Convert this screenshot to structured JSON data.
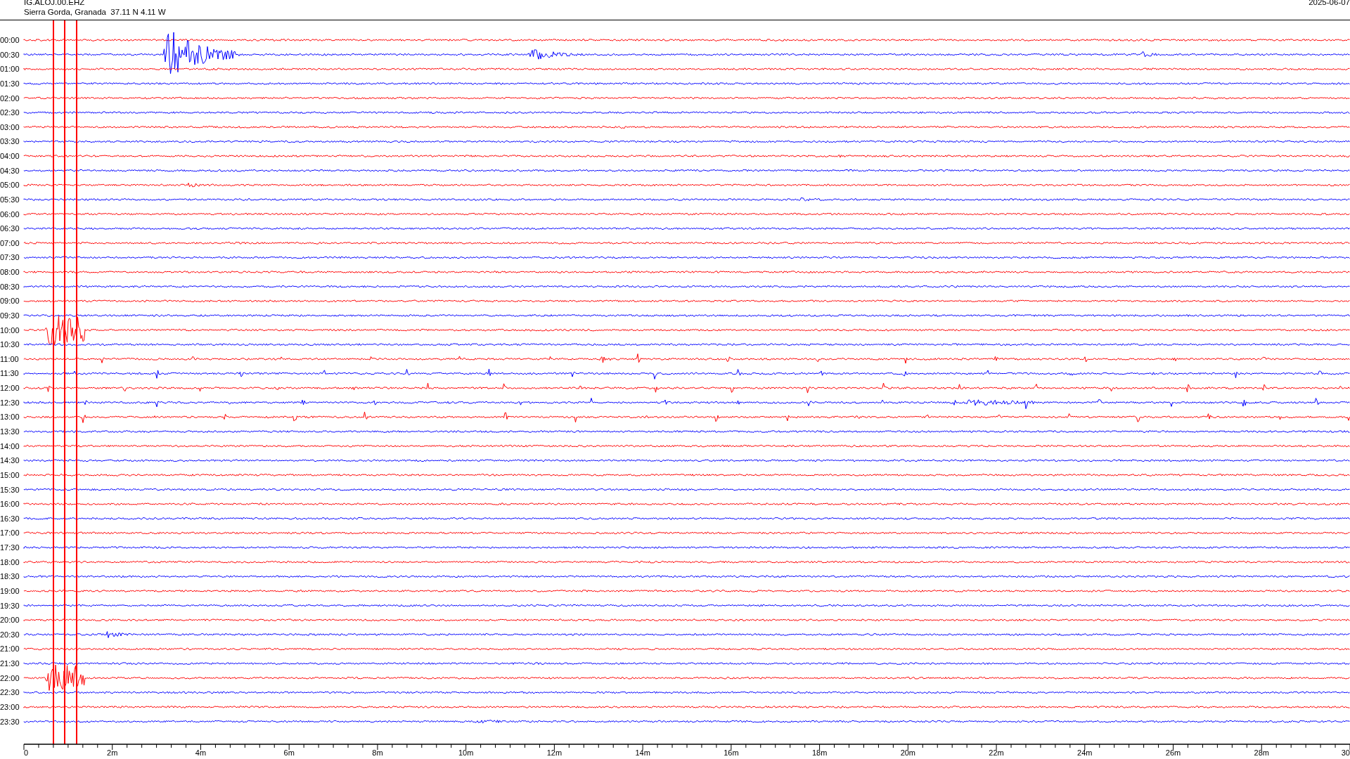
{
  "station": {
    "code": "IG.ALOJ.00.EHZ",
    "location": "Sierra Gorda, Granada  37.11 N 4.11 W"
  },
  "date": "2025-06-07",
  "rows": [
    {
      "label": "00:00",
      "color": "#ff0000"
    },
    {
      "label": "00:30",
      "color": "#0000ff"
    },
    {
      "label": "01:00",
      "color": "#ff0000"
    },
    {
      "label": "01:30",
      "color": "#0000ff"
    },
    {
      "label": "02:00",
      "color": "#ff0000"
    },
    {
      "label": "02:30",
      "color": "#0000ff"
    },
    {
      "label": "03:00",
      "color": "#ff0000"
    },
    {
      "label": "03:30",
      "color": "#0000ff"
    },
    {
      "label": "04:00",
      "color": "#ff0000"
    },
    {
      "label": "04:30",
      "color": "#0000ff"
    },
    {
      "label": "05:00",
      "color": "#ff0000"
    },
    {
      "label": "05:30",
      "color": "#0000ff"
    },
    {
      "label": "06:00",
      "color": "#ff0000"
    },
    {
      "label": "06:30",
      "color": "#0000ff"
    },
    {
      "label": "07:00",
      "color": "#ff0000"
    },
    {
      "label": "07:30",
      "color": "#0000ff"
    },
    {
      "label": "08:00",
      "color": "#ff0000"
    },
    {
      "label": "08:30",
      "color": "#0000ff"
    },
    {
      "label": "09:00",
      "color": "#ff0000"
    },
    {
      "label": "09:30",
      "color": "#0000ff"
    },
    {
      "label": "10:00",
      "color": "#ff0000"
    },
    {
      "label": "10:30",
      "color": "#0000ff"
    },
    {
      "label": "11:00",
      "color": "#ff0000"
    },
    {
      "label": "11:30",
      "color": "#0000ff"
    },
    {
      "label": "12:00",
      "color": "#ff0000"
    },
    {
      "label": "12:30",
      "color": "#0000ff"
    },
    {
      "label": "13:00",
      "color": "#ff0000"
    },
    {
      "label": "13:30",
      "color": "#0000ff"
    },
    {
      "label": "14:00",
      "color": "#ff0000"
    },
    {
      "label": "14:30",
      "color": "#0000ff"
    },
    {
      "label": "15:00",
      "color": "#ff0000"
    },
    {
      "label": "15:30",
      "color": "#0000ff"
    },
    {
      "label": "16:00",
      "color": "#ff0000"
    },
    {
      "label": "16:30",
      "color": "#0000ff"
    },
    {
      "label": "17:00",
      "color": "#ff0000"
    },
    {
      "label": "17:30",
      "color": "#0000ff"
    },
    {
      "label": "18:00",
      "color": "#ff0000"
    },
    {
      "label": "18:30",
      "color": "#0000ff"
    },
    {
      "label": "19:00",
      "color": "#ff0000"
    },
    {
      "label": "19:30",
      "color": "#0000ff"
    },
    {
      "label": "20:00",
      "color": "#ff0000"
    },
    {
      "label": "20:30",
      "color": "#0000ff"
    },
    {
      "label": "21:00",
      "color": "#ff0000"
    },
    {
      "label": "21:30",
      "color": "#0000ff"
    },
    {
      "label": "22:00",
      "color": "#ff0000"
    },
    {
      "label": "22:30",
      "color": "#0000ff"
    },
    {
      "label": "23:00",
      "color": "#ff0000"
    },
    {
      "label": "23:30",
      "color": "#0000ff"
    }
  ],
  "x_ticks": [
    "0",
    "2m",
    "4m",
    "6m",
    "8m",
    "10m",
    "12m",
    "14m",
    "16m",
    "18m",
    "20m",
    "22m",
    "24m",
    "26m",
    "28m",
    "30"
  ]
}
